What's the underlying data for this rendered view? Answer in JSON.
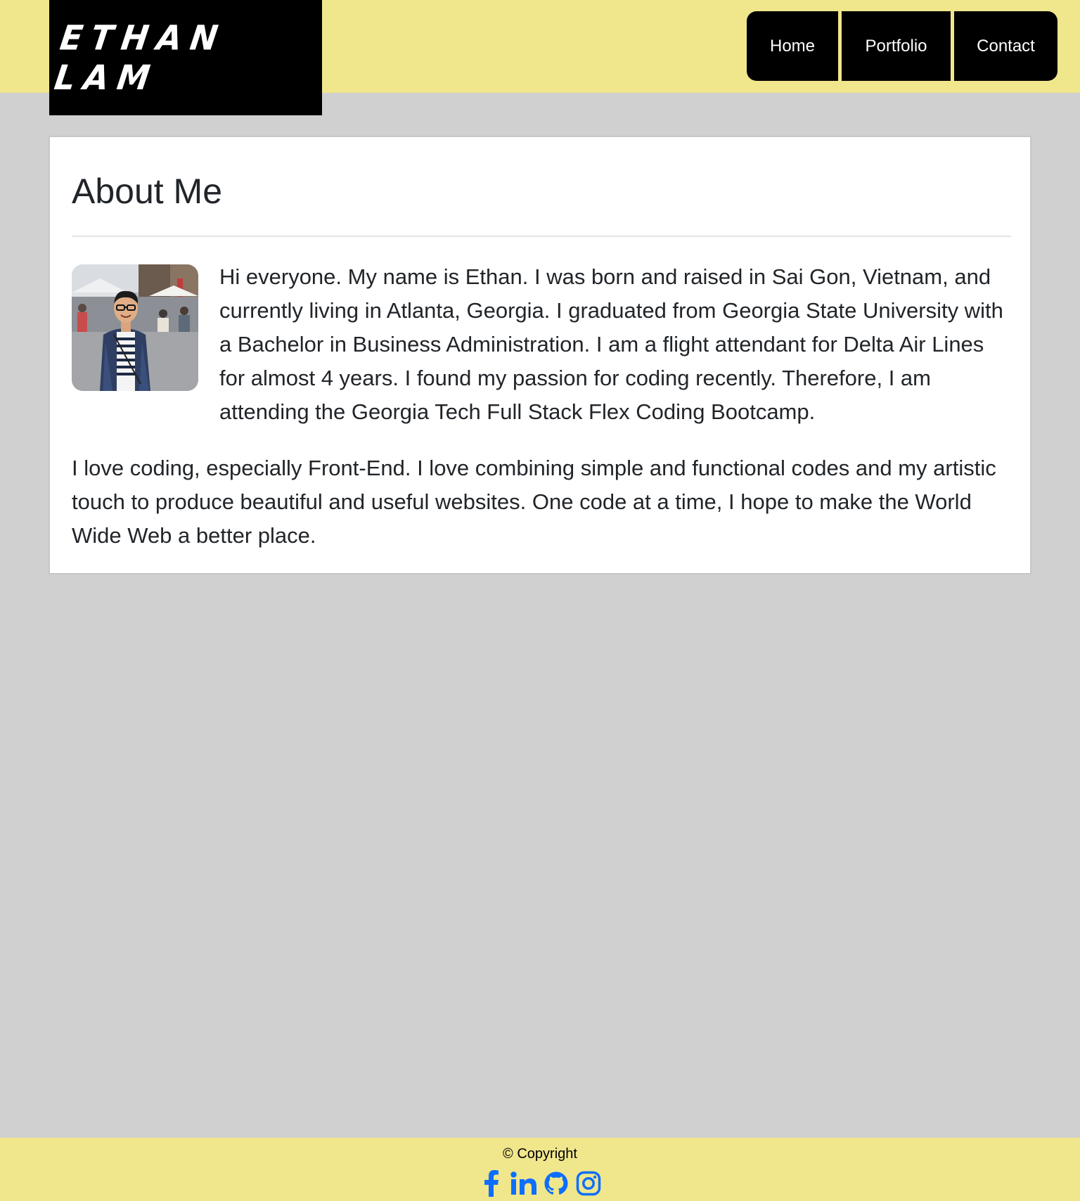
{
  "header": {
    "brand": "Ethan Lam",
    "nav": [
      {
        "label": "Home"
      },
      {
        "label": "Portfolio"
      },
      {
        "label": "Contact"
      }
    ]
  },
  "about": {
    "title": "About Me",
    "avatar_alt": "Photo of Ethan",
    "paragraph_1": "Hi everyone. My name is Ethan. I was born and raised in Sai Gon, Vietnam, and currently living in Atlanta, Georgia. I graduated from Georgia State University with a Bachelor in Business Administration. I am a flight attendant for Delta Air Lines for almost 4 years. I found my passion for coding recently. Therefore, I am attending the Georgia Tech Full Stack Flex Coding Bootcamp.",
    "paragraph_2": "I love coding, especially Front-End. I love combining simple and functional codes and my artistic touch to produce beautiful and useful websites. One code at a time, I hope to make the World Wide Web a better place."
  },
  "footer": {
    "copyright": "© Copyright",
    "socials": [
      {
        "icon": "facebook-icon"
      },
      {
        "icon": "linkedin-icon"
      },
      {
        "icon": "github-icon"
      },
      {
        "icon": "instagram-icon"
      }
    ]
  },
  "colors": {
    "header_bg": "#f0e68c",
    "page_bg": "#d0d0d0",
    "brand_bg": "#000000",
    "social_icon": "#0d6efd"
  }
}
